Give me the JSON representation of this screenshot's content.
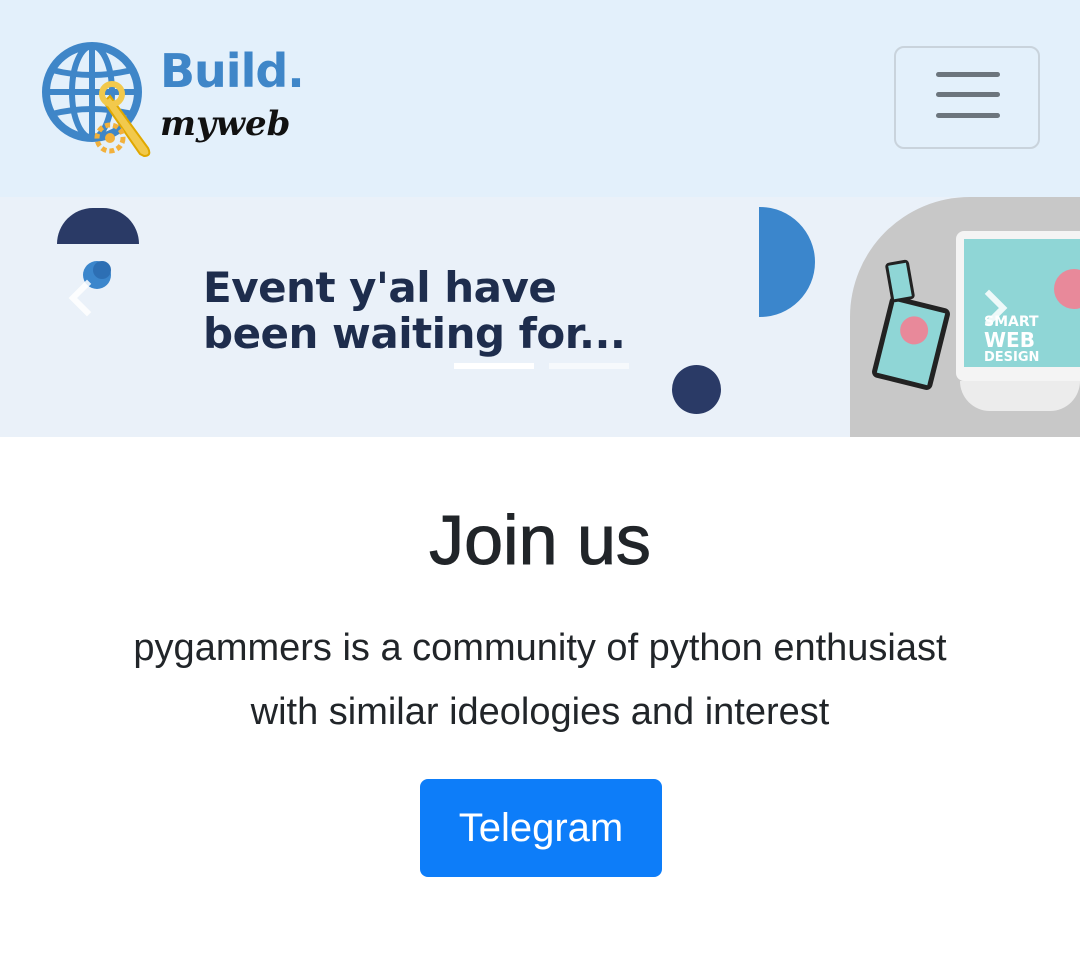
{
  "navbar": {
    "brand_line1": "Build.",
    "brand_line2": "myweb",
    "logo_icon": "globe-wrench-gear-icon",
    "toggler_icon": "hamburger-menu-icon",
    "background_color": "#e3f0fb"
  },
  "carousel": {
    "slide_headline_line1": "Event y'al have",
    "slide_headline_line2": "been waiting for...",
    "slide_device_text_line1": "SMART",
    "slide_device_text_line2": "WEB",
    "slide_device_text_line3": "DESIGN",
    "prev_icon": "chevron-left-icon",
    "next_icon": "chevron-right-icon",
    "indicator_count": 2,
    "active_indicator": 0
  },
  "join": {
    "title": "Join us",
    "text_line1": "pygammers is a community of python enthusiast",
    "text_line2": "with similar ideologies and interest",
    "button_label": "Telegram",
    "button_color": "#0d7df9"
  }
}
